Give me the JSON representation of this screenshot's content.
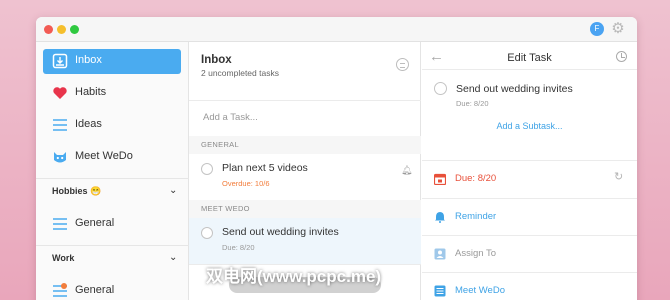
{
  "profile": {
    "initial": "F"
  },
  "sidebar": {
    "items": [
      {
        "label": "Inbox",
        "active": true,
        "icon": "inbox-icon"
      },
      {
        "label": "Habits",
        "active": false,
        "icon": "heart-icon"
      },
      {
        "label": "Ideas",
        "active": false,
        "icon": "list-icon"
      },
      {
        "label": "Meet WeDo",
        "active": false,
        "icon": "mascot-icon"
      }
    ],
    "hobbies": {
      "heading": "Hobbies 😁",
      "items": [
        {
          "label": "General",
          "icon": "list-icon"
        }
      ]
    },
    "work": {
      "heading": "Work",
      "items": [
        {
          "label": "General",
          "icon": "list-icon",
          "badge": "1"
        }
      ]
    }
  },
  "inbox": {
    "title": "Inbox",
    "subtitle": "2 uncompleted tasks",
    "add_task_placeholder": "Add a Task...",
    "sections": [
      {
        "heading": "GENERAL",
        "tasks": [
          {
            "title": "Plan next 5 videos",
            "meta": "Overdue: 10/6",
            "overdue": true
          }
        ]
      },
      {
        "heading": "MEET WEDO",
        "tasks": [
          {
            "title": "Send out wedding invites",
            "meta": "Due: 8/20",
            "overdue": false
          }
        ]
      }
    ]
  },
  "edit_task": {
    "title": "Edit Task",
    "task_title": "Send out wedding invites",
    "task_due": "Due: 8/20",
    "add_subtask": "Add a Subtask...",
    "rows": [
      {
        "label": "Due: 8/20",
        "icon": "calendar-icon",
        "color": "#e8503a"
      },
      {
        "label": "Reminder",
        "icon": "bell-icon",
        "color": "#3fa3e6"
      },
      {
        "label": "Assign To",
        "icon": "person-icon",
        "color": "#9a9a9a"
      },
      {
        "label": "Meet WeDo",
        "icon": "list-icon",
        "color": "#3fa3e6"
      }
    ]
  },
  "watermark": "双电网(www.pcpc.me)",
  "colors": {
    "accent": "#4aabf0",
    "overdue": "#f27d3c",
    "due_red": "#e8503a"
  }
}
